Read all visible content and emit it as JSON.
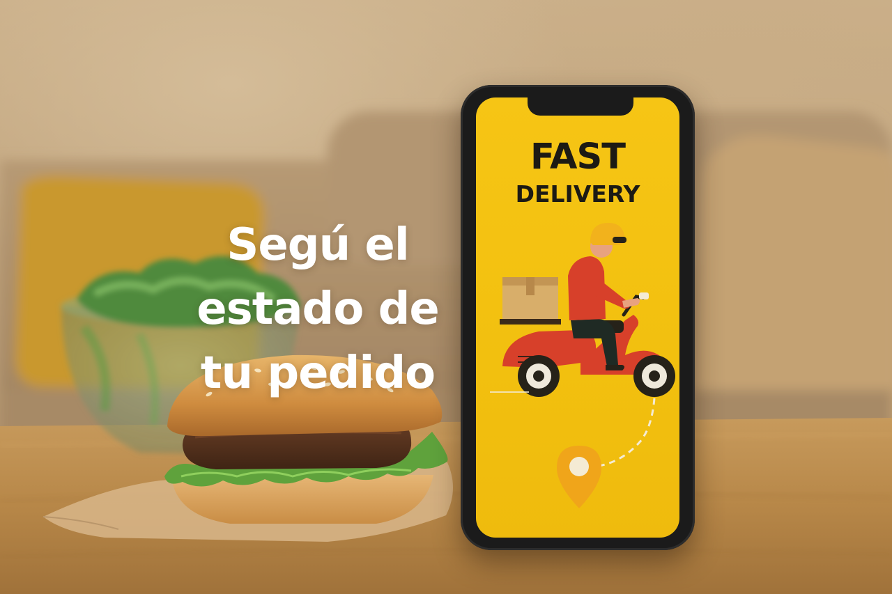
{
  "headline": {
    "line1": "Segú el",
    "line2": "estado de",
    "line3": "tu pedido"
  },
  "phone_screen": {
    "title_line1": "FAST",
    "title_line2": "DELIVERY"
  },
  "colors": {
    "screen_yellow": "#f4c212",
    "scooter_red": "#d7402a",
    "helmet_yellow": "#f2b21c",
    "pin_orange": "#f0a51a"
  }
}
